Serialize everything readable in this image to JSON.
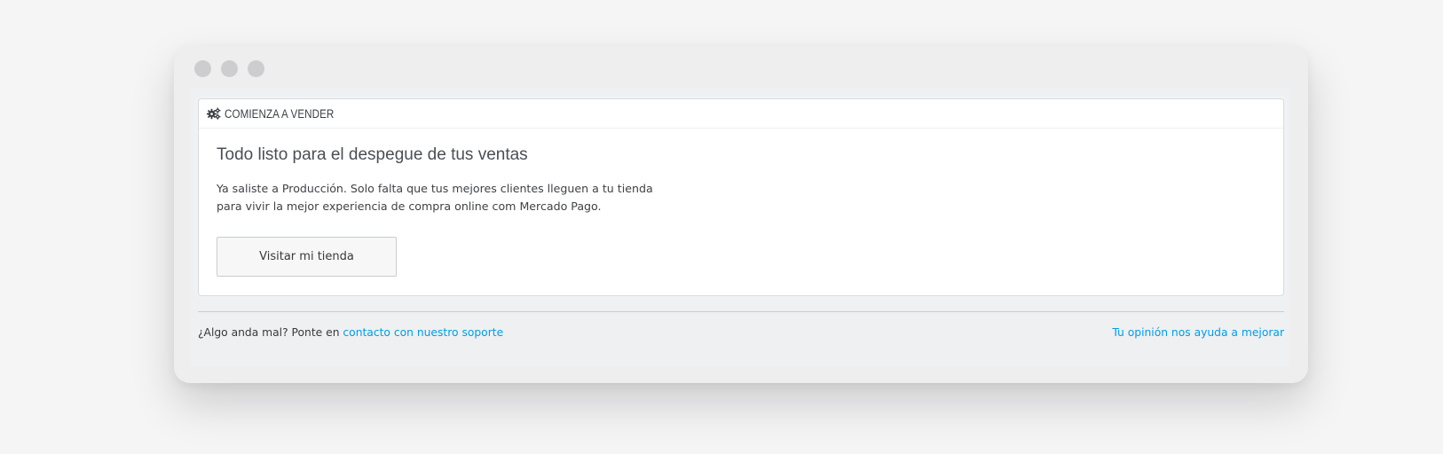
{
  "window": {
    "traffic_lights": [
      "close",
      "minimize",
      "maximize"
    ]
  },
  "panel": {
    "icon": "gears-icon",
    "title": "COMIENZA A VENDER",
    "heading": "Todo listo para el despegue de tus ventas",
    "text_line_1": "Ya saliste a Producción. Solo falta que tus mejores clientes lleguen a tu tienda",
    "text_line_2": "para vivir la mejor experiencia de compra online com Mercado Pago.",
    "button_label": "Visitar mi tienda"
  },
  "footer": {
    "prefix": "¿Algo anda mal? Ponte en ",
    "support_link": "contacto con nuestro soporte",
    "feedback_link": "Tu opinión nos ayuda a mejorar"
  },
  "colors": {
    "background": "#f5f5f6",
    "window": "#eeeeef",
    "link": "#009ee3",
    "traffic_light": "#cdcdcf"
  }
}
